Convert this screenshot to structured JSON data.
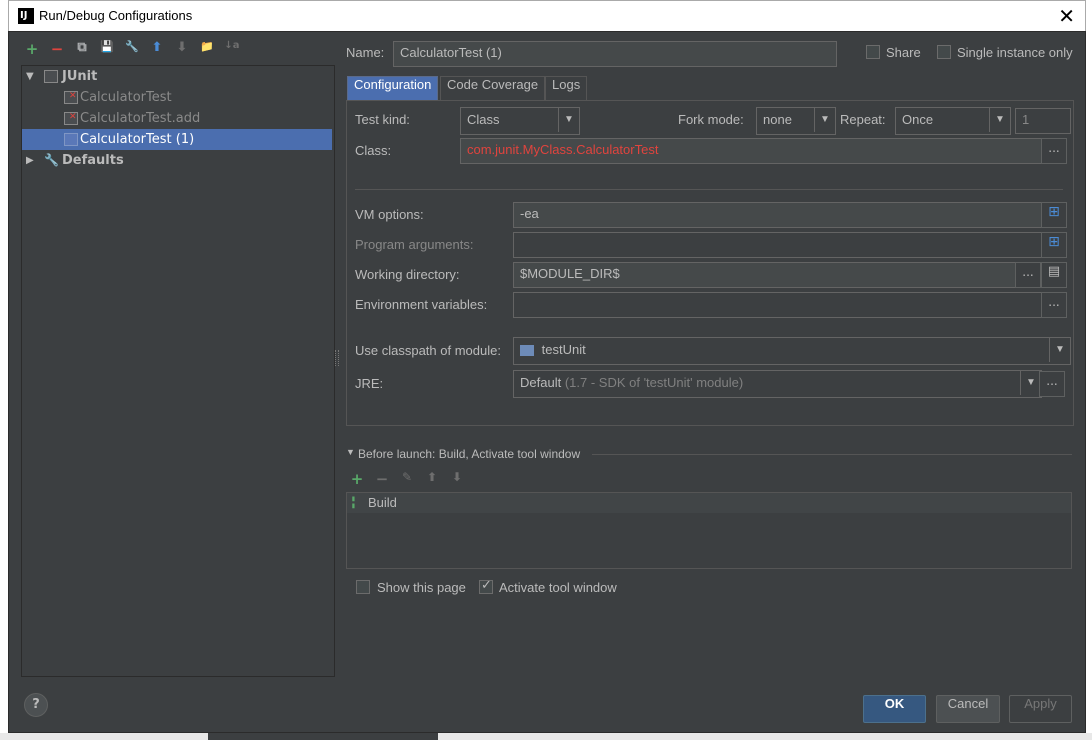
{
  "window": {
    "title": "Run/Debug Configurations",
    "logo": "IJ",
    "close_glyph": "✕"
  },
  "toolbar": {
    "icons": [
      "+",
      "−",
      "⧉",
      "💾",
      "🔧",
      "⬆",
      "⬇",
      "📁",
      "↓a"
    ]
  },
  "tree": {
    "junit_label": "JUnit",
    "items": [
      "CalculatorTest",
      "CalculatorTest.add",
      "CalculatorTest (1)"
    ],
    "defaults_label": "Defaults"
  },
  "header": {
    "name_label": "Name:",
    "name_value": "CalculatorTest (1)",
    "share_label": "Share",
    "single_instance_label": "Single instance only"
  },
  "tabs": [
    "Configuration",
    "Code Coverage",
    "Logs"
  ],
  "config": {
    "test_kind_label": "Test kind:",
    "test_kind_value": "Class",
    "fork_mode_label": "Fork mode:",
    "fork_mode_value": "none",
    "repeat_label": "Repeat:",
    "repeat_value": "Once",
    "repeat_count": "1",
    "class_label": "Class:",
    "class_value": "com.junit.MyClass.CalculatorTest",
    "vm_options_label": "VM options:",
    "vm_options_value": "-ea",
    "program_args_label": "Program arguments:",
    "program_args_value": "",
    "working_dir_label": "Working directory:",
    "working_dir_value": "$MODULE_DIR$",
    "env_vars_label": "Environment variables:",
    "env_vars_value": "",
    "classpath_label": "Use classpath of module:",
    "classpath_value": "testUnit",
    "jre_label": "JRE:",
    "jre_value": "Default",
    "jre_detail": "(1.7 - SDK of 'testUnit' module)",
    "ellipsis": "...",
    "colors": {
      "class_text": "#e0443e",
      "accent": "#4b6eaf"
    }
  },
  "before_launch": {
    "header": "Before launch: Build, Activate tool window",
    "toolbar": [
      "+",
      "−",
      "✎",
      "⬆",
      "⬇"
    ],
    "items": [
      "Build"
    ],
    "show_page_label": "Show this page",
    "activate_tool_label": "Activate tool window"
  },
  "buttons": {
    "help": "?",
    "ok": "OK",
    "cancel": "Cancel",
    "apply": "Apply"
  }
}
